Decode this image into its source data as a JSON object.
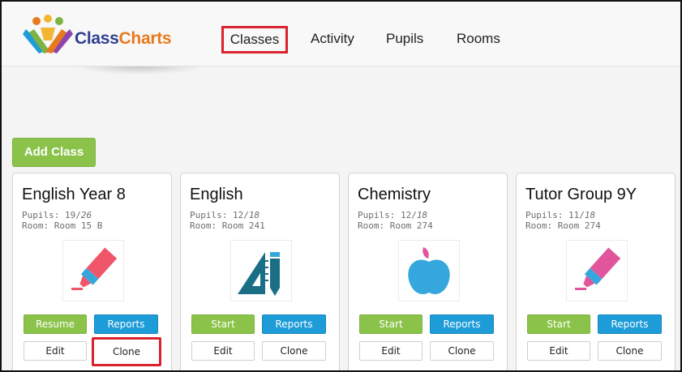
{
  "brand": {
    "part1": "Class",
    "part2": "Charts"
  },
  "nav": {
    "items": [
      {
        "label": "Classes",
        "active": true
      },
      {
        "label": "Activity"
      },
      {
        "label": "Pupils"
      },
      {
        "label": "Rooms"
      }
    ]
  },
  "toolbar": {
    "add_class_label": "Add Class"
  },
  "classes": [
    {
      "title": "English Year 8",
      "pupils_label": "Pupils:",
      "pupils_count": "19",
      "pupils_total": "26",
      "room_text": "Room: Room 15 B",
      "icon": "highlighter-icon",
      "primary_label": "Resume",
      "reports_label": "Reports",
      "edit_label": "Edit",
      "clone_label": "Clone"
    },
    {
      "title": "English",
      "pupils_label": "Pupils:",
      "pupils_count": "12",
      "pupils_total": "18",
      "room_text": "Room: Room 241",
      "icon": "ruler-pencil-icon",
      "primary_label": "Start",
      "reports_label": "Reports",
      "edit_label": "Edit",
      "clone_label": "Clone"
    },
    {
      "title": "Chemistry",
      "pupils_label": "Pupils:",
      "pupils_count": "12",
      "pupils_total": "18",
      "room_text": "Room: Room 274",
      "icon": "apple-icon",
      "primary_label": "Start",
      "reports_label": "Reports",
      "edit_label": "Edit",
      "clone_label": "Clone"
    },
    {
      "title": "Tutor Group 9Y",
      "pupils_label": "Pupils:",
      "pupils_count": "11",
      "pupils_total": "18",
      "room_text": "Room: Room 274",
      "icon": "highlighter-icon",
      "primary_label": "Start",
      "reports_label": "Reports",
      "edit_label": "Edit",
      "clone_label": "Clone"
    }
  ],
  "colors": {
    "brand_navy": "#2e3f8f",
    "brand_orange": "#e87a1e",
    "green": "#8bc34a",
    "blue": "#1e9cd8",
    "highlight_red": "#d9232e",
    "highlighter_red": "#f0566a",
    "highlighter_pink": "#e0559b",
    "icon_teal": "#1a6f86",
    "apple_blue": "#35a7dc"
  }
}
